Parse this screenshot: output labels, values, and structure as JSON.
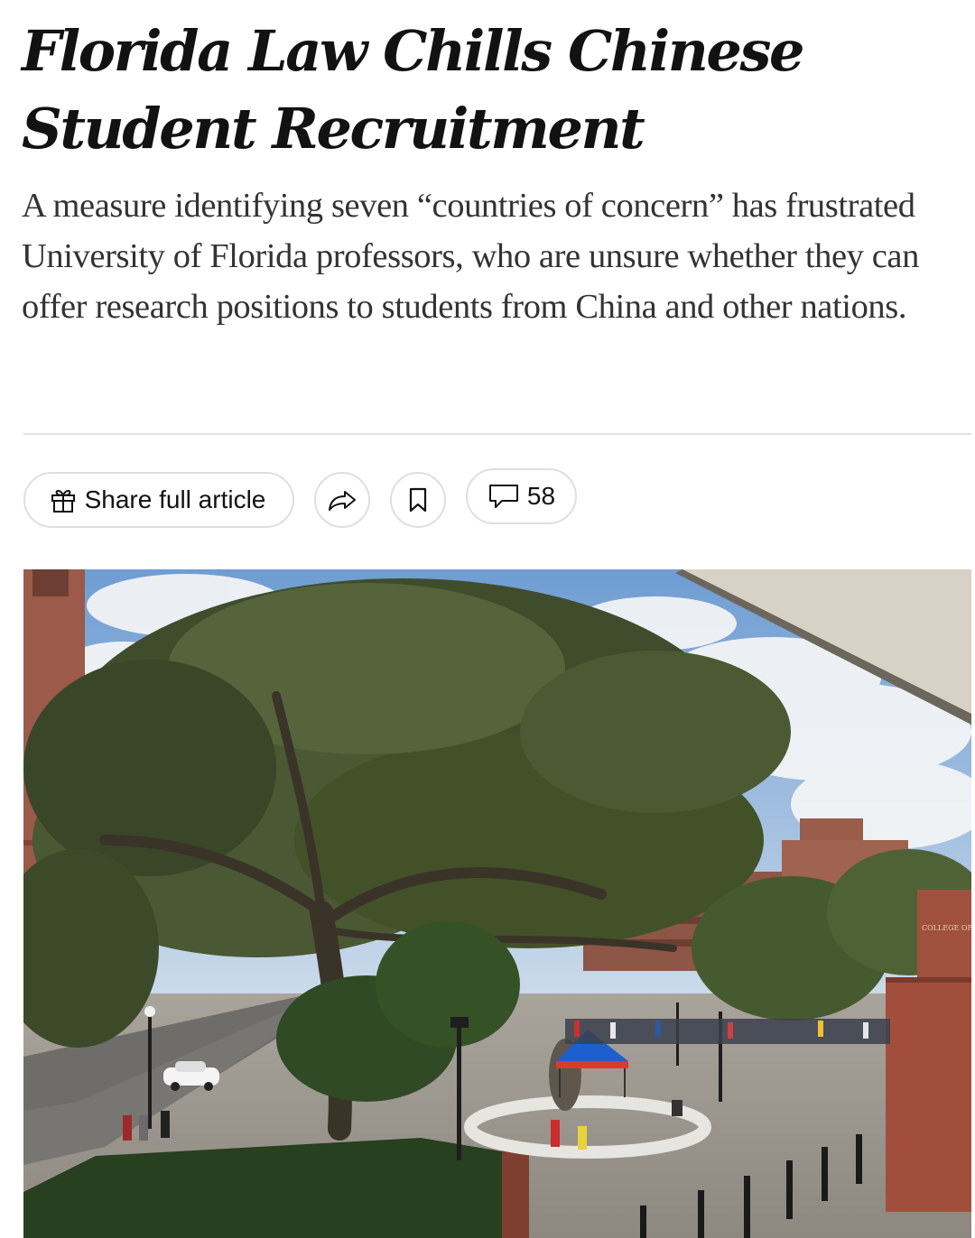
{
  "article": {
    "headline": "Florida Law Chills Chinese Student Recruitment",
    "summary": "A measure identifying seven “countries of concern” has frustrated University of Florida professors, who are unsure whether they can offer research positions to students from China and other nations."
  },
  "toolbar": {
    "share_full_label": "Share full article",
    "gift_icon": "gift-icon",
    "share_icon": "share-arrow-icon",
    "save_icon": "bookmark-icon",
    "comment_icon": "comment-bubble-icon",
    "comment_count": "58"
  },
  "photo": {
    "building_sign": "COLLEGE OF LIBERAL ARTS"
  },
  "colors": {
    "headline": "#121212",
    "summary": "#333333",
    "divider": "#e2e2e2",
    "pill_border": "#dfdfdf",
    "tent_blue": "#1e5fd0",
    "brick": "#8f4a3c"
  }
}
